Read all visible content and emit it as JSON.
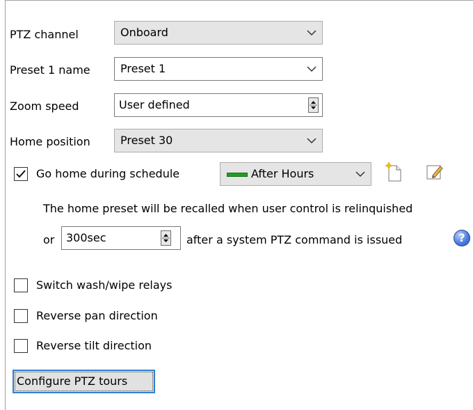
{
  "ptz_channel": {
    "label": "PTZ channel",
    "value": "Onboard"
  },
  "preset_name": {
    "label": "Preset 1 name",
    "value": "Preset 1"
  },
  "zoom_speed": {
    "label": "Zoom speed",
    "value": "User defined"
  },
  "home_position": {
    "label": "Home position",
    "value": "Preset 30"
  },
  "go_home": {
    "label": "Go home during schedule",
    "checked": true,
    "schedule": "After Hours",
    "schedule_color": "#22a022"
  },
  "home_info": {
    "line1": "The home preset will be recalled when user control is relinquished",
    "or_label": "or",
    "delay_value": "300sec",
    "line2_suffix": "after a system PTZ command is issued",
    "help_glyph": "?"
  },
  "options": [
    {
      "label": "Switch wash/wipe relays",
      "checked": false
    },
    {
      "label": "Reverse pan direction",
      "checked": false
    },
    {
      "label": "Reverse tilt direction",
      "checked": false
    }
  ],
  "configure_button": "Configure PTZ tours",
  "colors": {
    "focus_blue": "#2f7fd0",
    "combo_gray": "#e5e5e5"
  }
}
